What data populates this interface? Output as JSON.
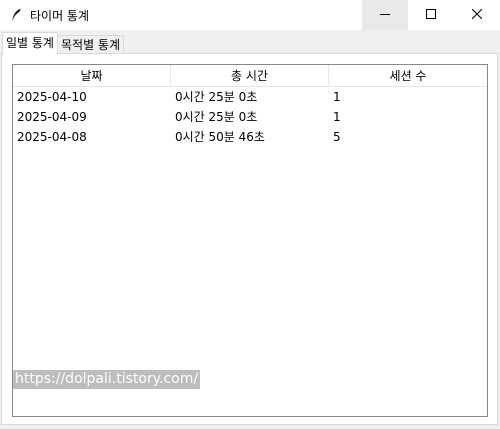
{
  "window": {
    "title": "타이머 통계",
    "icon": "feather-icon",
    "controls": {
      "minimize_icon": "minimize-icon",
      "maximize_icon": "maximize-icon",
      "close_icon": "close-icon"
    }
  },
  "tabs": [
    {
      "label": "일별 통계",
      "active": true
    },
    {
      "label": "목적별 통계",
      "active": false
    }
  ],
  "table": {
    "columns": [
      "날짜",
      "총 시간",
      "세션 수"
    ],
    "rows": [
      [
        "2025-04-10",
        "0시간 25분 0초",
        "1"
      ],
      [
        "2025-04-09",
        "0시간 25분 0초",
        "1"
      ],
      [
        "2025-04-08",
        "0시간 50분 46초",
        "5"
      ]
    ]
  },
  "watermark": "https://dolpali.tistory.com/"
}
